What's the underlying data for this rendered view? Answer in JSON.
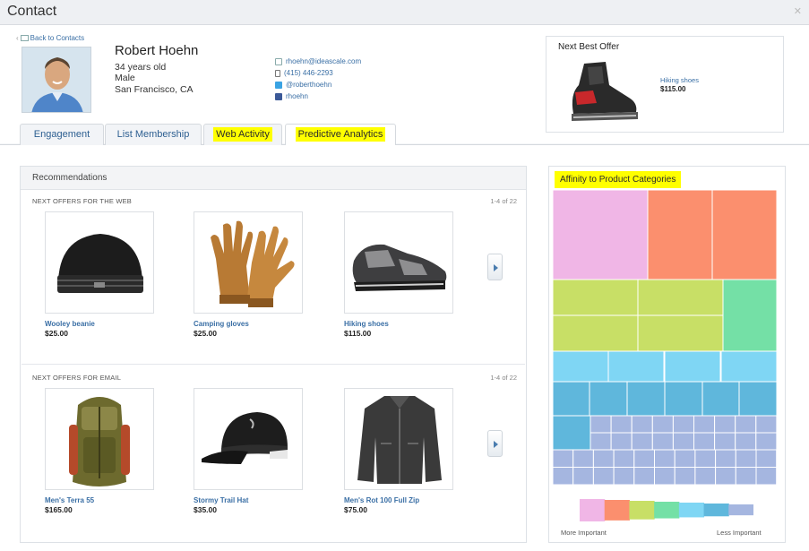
{
  "window": {
    "title": "Contact"
  },
  "nav": {
    "back_label": "Back to Contacts"
  },
  "contact": {
    "name": "Robert Hoehn",
    "age": "34 years old",
    "gender": "Male",
    "location": "San Francisco, CA",
    "email": "rhoehn@ideascale.com",
    "phone": "(415) 446-2293",
    "twitter": "@roberthoehn",
    "facebook": "rhoehn"
  },
  "next_best_offer": {
    "heading": "Next Best Offer",
    "product_name": "Hiking shoes",
    "product_price": "$115.00"
  },
  "tabs": [
    {
      "label": "Engagement",
      "highlighted": false
    },
    {
      "label": "List Membership",
      "highlighted": false
    },
    {
      "label": "Web Activity",
      "highlighted": true
    },
    {
      "label": "Predictive Analytics",
      "highlighted": true,
      "active": true
    }
  ],
  "recommendations": {
    "heading": "Recommendations",
    "web": {
      "label": "NEXT OFFERS FOR THE WEB",
      "count": "1-4 of 22",
      "items": [
        {
          "name": "Wooley beanie",
          "price": "$25.00",
          "icon": "beanie-icon"
        },
        {
          "name": "Camping gloves",
          "price": "$25.00",
          "icon": "gloves-icon"
        },
        {
          "name": "Hiking shoes",
          "price": "$115.00",
          "icon": "shoe-icon"
        }
      ]
    },
    "email": {
      "label": "NEXT OFFERS FOR EMAIL",
      "count": "1-4 of 22",
      "items": [
        {
          "name": "Men's Terra 55",
          "price": "$165.00",
          "icon": "backpack-icon"
        },
        {
          "name": "Stormy Trail Hat",
          "price": "$35.00",
          "icon": "cap-icon"
        },
        {
          "name": "Men's Rot 100 Full Zip",
          "price": "$75.00",
          "icon": "jacket-icon"
        }
      ]
    }
  },
  "affinity": {
    "heading": "Affinity to Product Categories",
    "legend_more": "More Important",
    "legend_less": "Less Important",
    "colors": [
      "#f0b6e6",
      "#fb8f6e",
      "#c8df66",
      "#74e0a6",
      "#7fd6f4",
      "#5fb7dc",
      "#a5b6e0"
    ]
  }
}
